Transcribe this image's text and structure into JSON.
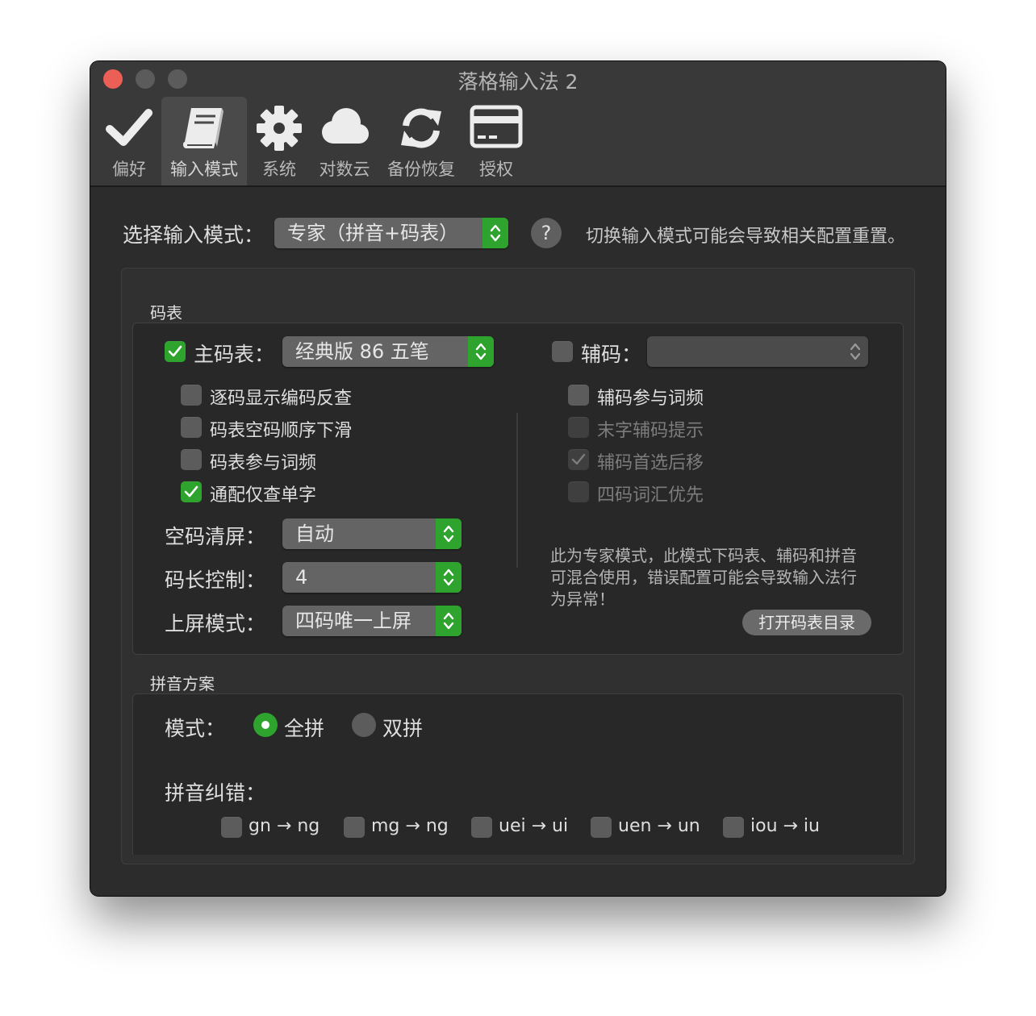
{
  "window": {
    "title": "落格输入法 2"
  },
  "toolbar": {
    "tabs": [
      {
        "label": "偏好"
      },
      {
        "label": "输入模式"
      },
      {
        "label": "系统"
      },
      {
        "label": "对数云"
      },
      {
        "label": "备份恢复"
      },
      {
        "label": "授权"
      }
    ]
  },
  "mode_select": {
    "label": "选择输入模式：",
    "value": "专家（拼音+码表）",
    "help": "?",
    "hint": "切换输入模式可能会导致相关配置重置。"
  },
  "codetable": {
    "section_title": "码表",
    "main": {
      "label": "主码表：",
      "checked": true,
      "value": "经典版 86 五笔"
    },
    "aux": {
      "label": "辅码：",
      "checked": false,
      "value": ""
    },
    "left_options": [
      {
        "label": "逐码显示编码反查",
        "checked": false
      },
      {
        "label": "码表空码顺序下滑",
        "checked": false
      },
      {
        "label": "码表参与词频",
        "checked": false
      },
      {
        "label": "通配仅查单字",
        "checked": true
      }
    ],
    "right_options": [
      {
        "label": "辅码参与词频",
        "checked": false,
        "enabled": true
      },
      {
        "label": "末字辅码提示",
        "checked": false,
        "enabled": false
      },
      {
        "label": "辅码首选后移",
        "checked": true,
        "enabled": false
      },
      {
        "label": "四码词汇优先",
        "checked": false,
        "enabled": false
      }
    ],
    "empty_clear": {
      "label": "空码清屏：",
      "value": "自动"
    },
    "code_length": {
      "label": "码长控制：",
      "value": "4"
    },
    "commit_mode": {
      "label": "上屏模式：",
      "value": "四码唯一上屏"
    },
    "note": "此为专家模式，此模式下码表、辅码和拼音可混合使用，错误配置可能会导致输入法行为异常！",
    "open_button": "打开码表目录"
  },
  "pinyin": {
    "section_title": "拼音方案",
    "mode_label": "模式：",
    "modes": [
      {
        "label": "全拼",
        "selected": true
      },
      {
        "label": "双拼",
        "selected": false
      }
    ],
    "correction_label": "拼音纠错：",
    "corrections": [
      {
        "label": "gn → ng",
        "checked": false
      },
      {
        "label": "mg → ng",
        "checked": false
      },
      {
        "label": "uei → ui",
        "checked": false
      },
      {
        "label": "uen → un",
        "checked": false
      },
      {
        "label": "iou → iu",
        "checked": false
      }
    ]
  },
  "colors": {
    "accent": "#2ea32e",
    "window_bg": "#2c2c2c",
    "close_button": "#ec5f57"
  }
}
